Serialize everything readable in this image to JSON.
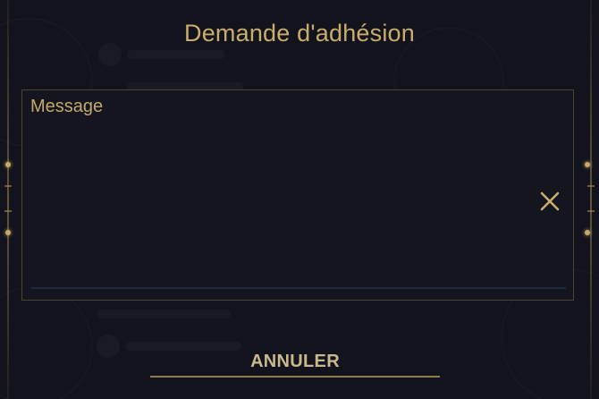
{
  "dialog": {
    "title": "Demande d'adhésion"
  },
  "message": {
    "placeholder": "Message",
    "value": ""
  },
  "icons": {
    "clear": "close-icon"
  },
  "actions": {
    "cancel_label": "ANNULER"
  },
  "colors": {
    "accent_gold": "#c9ad6b",
    "background": "#12131c",
    "border": "#4b4430",
    "input_underline": "#1e2a3e"
  }
}
